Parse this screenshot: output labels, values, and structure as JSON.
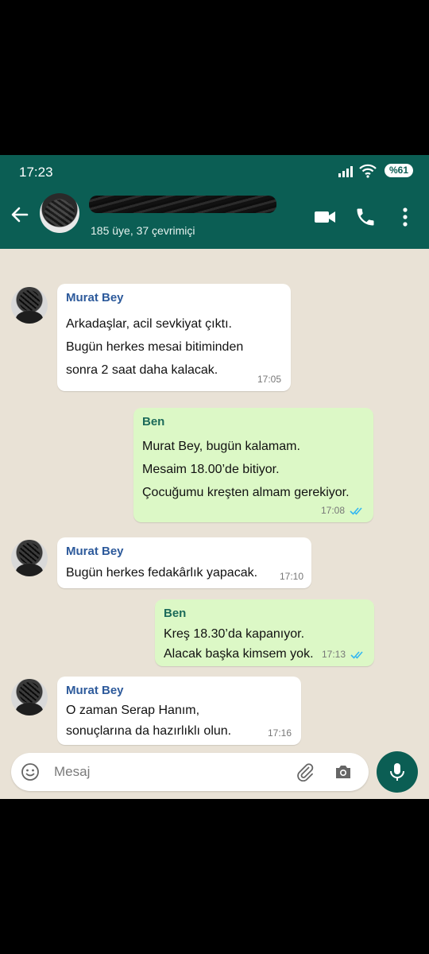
{
  "status_bar": {
    "time": "17:23",
    "battery": "%61"
  },
  "header": {
    "subtitle": "185 üye, 37 çevrimiçi"
  },
  "messages": [
    {
      "sender": "Murat Bey",
      "lines": [
        "Arkadaşlar, acil sevkiyat çıktı.",
        "Bugün herkes mesai bitiminden",
        "sonra 2 saat daha kalacak."
      ],
      "time": "17:05"
    },
    {
      "sender": "Ben",
      "lines": [
        "Murat Bey, bugün kalamam.",
        "Mesaim 18.00’de bitiyor.",
        "Çocuğumu kreşten almam gerekiyor."
      ],
      "time": "17:08"
    },
    {
      "sender": "Murat Bey",
      "lines": [
        "Bugün herkes fedakârlık yapacak."
      ],
      "time": "17:10"
    },
    {
      "sender": "Ben",
      "lines": [
        "Kreş 18.30’da kapanıyor.",
        "Alacak başka kimsem yok."
      ],
      "time": "17:13"
    },
    {
      "sender": "Murat Bey",
      "lines": [
        "O zaman Serap Hanım,",
        "sonuçlarına da hazırlıklı olun."
      ],
      "time": "17:16"
    }
  ],
  "composer": {
    "placeholder": "Mesaj"
  },
  "colors": {
    "header": "#0b5e54",
    "outgoing_bubble": "#dcf8c6",
    "incoming_bubble": "#ffffff",
    "read_ticks": "#34b7f1"
  }
}
